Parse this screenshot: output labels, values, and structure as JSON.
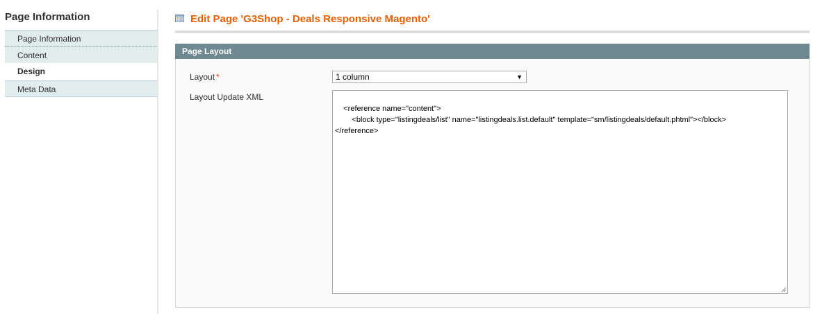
{
  "sidebar": {
    "title": "Page Information",
    "tabs": [
      {
        "label": "Page Information",
        "active": false
      },
      {
        "label": "Content",
        "active": false
      },
      {
        "label": "Design",
        "active": true
      },
      {
        "label": "Meta Data",
        "active": false
      }
    ]
  },
  "header": {
    "icon": "page-grid-icon",
    "title": "Edit Page 'G3Shop - Deals Responsive Magento'"
  },
  "fieldset": {
    "title": "Page Layout",
    "layout_label": "Layout",
    "layout_required_mark": "*",
    "layout_value": "1 column",
    "xml_label": "Layout Update XML",
    "xml_value": "<reference name=\"content\">\n        <block type=\"listingdeals/list\" name=\"listingdeals.list.default\" template=\"sm/listingdeals/default.phtml\"></block>\n</reference>"
  },
  "colors": {
    "accent": "#eb5e00",
    "section_header": "#6f8992",
    "tab_background": "#e1ecec",
    "required": "#eb340a"
  }
}
